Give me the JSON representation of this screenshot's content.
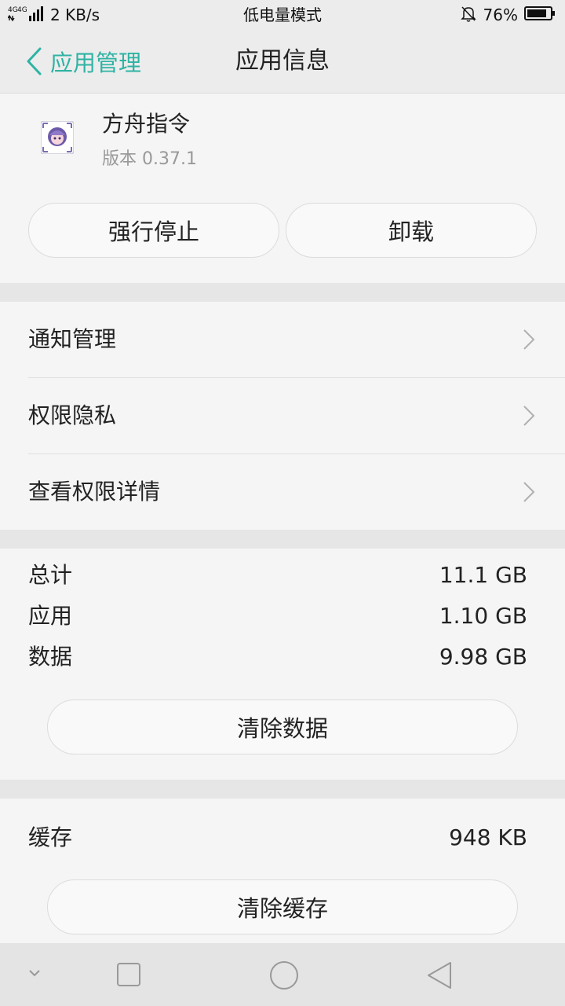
{
  "status_bar": {
    "network": "4G 4G",
    "speed": "2 KB/s",
    "mode": "低电量模式",
    "battery": "76%",
    "icons": [
      "signal-icon",
      "mute-bell-icon",
      "battery-icon"
    ]
  },
  "header": {
    "back_label": "应用管理",
    "title": "应用信息"
  },
  "app": {
    "name": "方舟指令",
    "version": "版本 0.37.1",
    "force_stop": "强行停止",
    "uninstall": "卸载"
  },
  "settings": {
    "items": [
      {
        "label": "通知管理"
      },
      {
        "label": "权限隐私"
      },
      {
        "label": "查看权限详情"
      }
    ]
  },
  "storage": {
    "total_label": "总计",
    "total_value": "11.1 GB",
    "app_label": "应用",
    "app_value": "1.10 GB",
    "data_label": "数据",
    "data_value": "9.98 GB",
    "clear_data": "清除数据"
  },
  "cache": {
    "label": "缓存",
    "value": "948 KB",
    "clear_cache": "清除缓存"
  },
  "colors": {
    "accent": "#2fb3a4",
    "background": "#f2f2f2",
    "separator": "#e6e6e6"
  }
}
